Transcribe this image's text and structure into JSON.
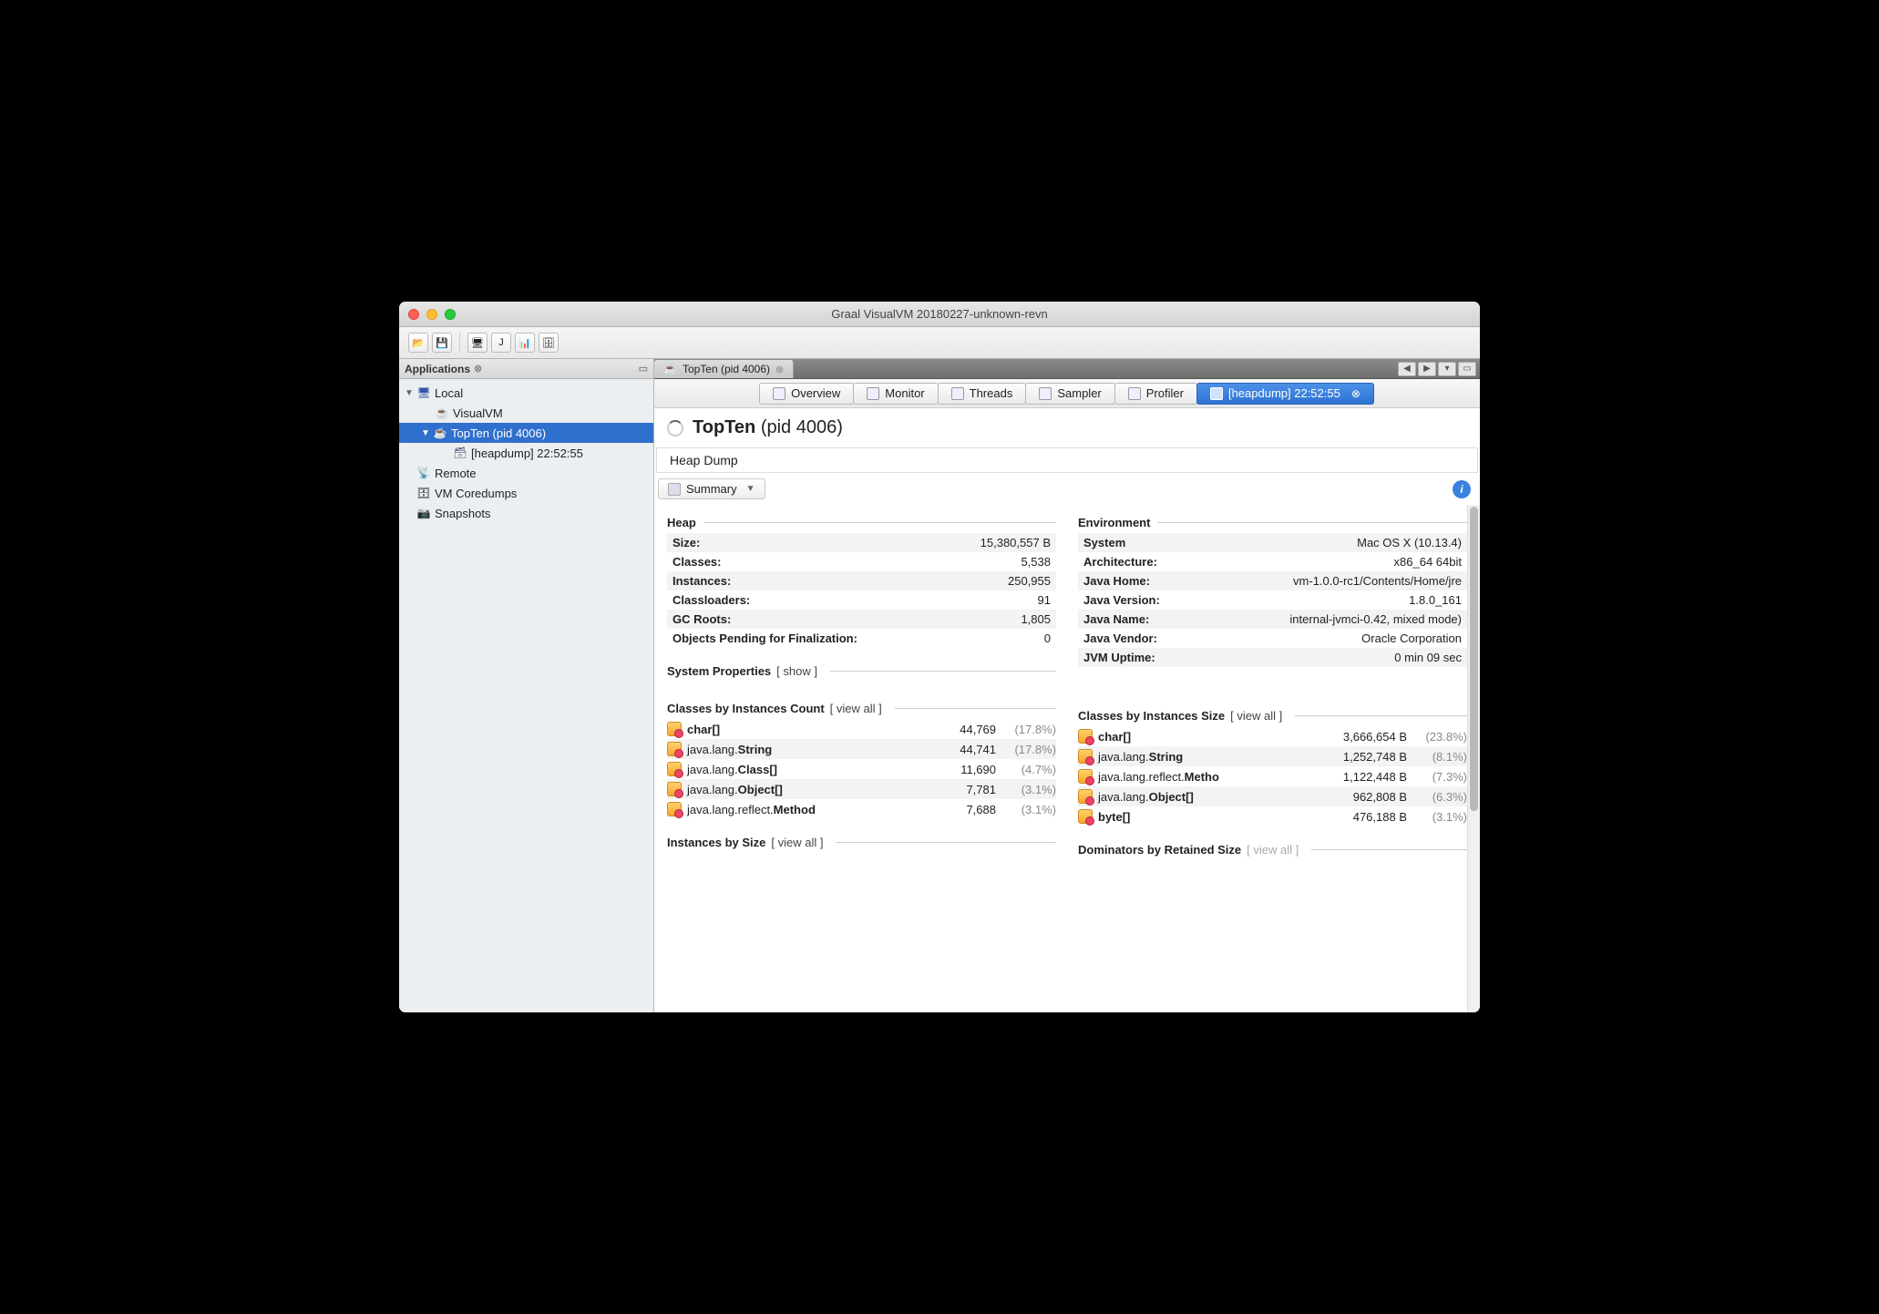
{
  "window": {
    "title": "Graal VisualVM 20180227-unknown-revn"
  },
  "sidebar": {
    "title": "Applications",
    "local_label": "Local",
    "visualvm_label": "VisualVM",
    "topten_label": "TopTen (pid 4006)",
    "heapdump_label": "[heapdump] 22:52:55",
    "remote_label": "Remote",
    "coredumps_label": "VM Coredumps",
    "snapshots_label": "Snapshots"
  },
  "main": {
    "tab_label": "TopTen (pid 4006)",
    "viewtabs": {
      "overview": "Overview",
      "monitor": "Monitor",
      "threads": "Threads",
      "sampler": "Sampler",
      "profiler": "Profiler",
      "heapdump": "[heapdump] 22:52:55"
    },
    "page_title_bold": "TopTen",
    "page_title_rest": "(pid 4006)",
    "subheader": "Heap Dump",
    "dropdown": "Summary"
  },
  "heap": {
    "title": "Heap",
    "rows": [
      {
        "k": "Size:",
        "v": "15,380,557 B"
      },
      {
        "k": "Classes:",
        "v": "5,538"
      },
      {
        "k": "Instances:",
        "v": "250,955"
      },
      {
        "k": "Classloaders:",
        "v": "91"
      },
      {
        "k": "GC Roots:",
        "v": "1,805"
      },
      {
        "k": "Objects Pending for Finalization:",
        "v": "0"
      }
    ]
  },
  "env": {
    "title": "Environment",
    "rows": [
      {
        "k": "System",
        "v": "Mac OS X (10.13.4)"
      },
      {
        "k": "Architecture:",
        "v": "x86_64 64bit"
      },
      {
        "k": "Java Home:",
        "v": "vm-1.0.0-rc1/Contents/Home/jre"
      },
      {
        "k": "Java Version:",
        "v": "1.8.0_161"
      },
      {
        "k": "Java Name:",
        "v": "internal-jvmci-0.42, mixed mode)"
      },
      {
        "k": "Java Vendor:",
        "v": "Oracle Corporation"
      },
      {
        "k": "JVM Uptime:",
        "v": "0 min 09 sec"
      }
    ]
  },
  "sysprops": {
    "title": "System Properties",
    "link": "[ show ]"
  },
  "by_count": {
    "title": "Classes by Instances Count",
    "link": "[ view all ]",
    "rows": [
      {
        "pkg": "",
        "cls": "char[]",
        "n": "44,769",
        "p": "(17.8%)"
      },
      {
        "pkg": "java.lang.",
        "cls": "String",
        "n": "44,741",
        "p": "(17.8%)"
      },
      {
        "pkg": "java.lang.",
        "cls": "Class[]",
        "n": "11,690",
        "p": "(4.7%)"
      },
      {
        "pkg": "java.lang.",
        "cls": "Object[]",
        "n": "7,781",
        "p": "(3.1%)"
      },
      {
        "pkg": "java.lang.reflect.",
        "cls": "Method",
        "n": "7,688",
        "p": "(3.1%)"
      }
    ]
  },
  "by_size": {
    "title": "Classes by Instances Size",
    "link": "[ view all ]",
    "rows": [
      {
        "pkg": "",
        "cls": "char[]",
        "n": "3,666,654 B",
        "p": "(23.8%)"
      },
      {
        "pkg": "java.lang.",
        "cls": "String",
        "n": "1,252,748 B",
        "p": "(8.1%)"
      },
      {
        "pkg": "java.lang.reflect.",
        "cls": "Metho",
        "n": "1,122,448 B",
        "p": "(7.3%)"
      },
      {
        "pkg": "java.lang.",
        "cls": "Object[]",
        "n": "962,808 B",
        "p": "(6.3%)"
      },
      {
        "pkg": "",
        "cls": "byte[]",
        "n": "476,188 B",
        "p": "(3.1%)"
      }
    ]
  },
  "inst_by_size": {
    "title": "Instances by Size",
    "link": "[ view all ]"
  },
  "dominators": {
    "title": "Dominators by Retained Size",
    "link": "[ view all ]"
  }
}
